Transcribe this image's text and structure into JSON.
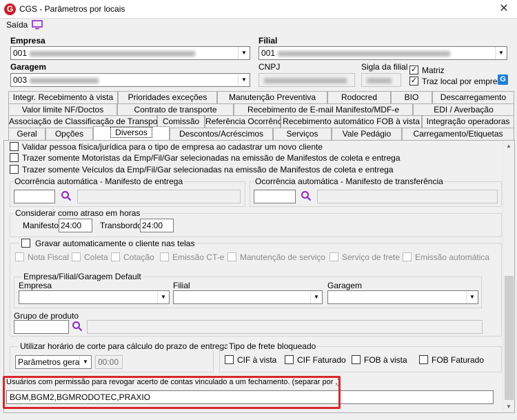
{
  "window": {
    "title": "CGS - Parâmetros por locais",
    "logo": "G",
    "close": "✕"
  },
  "menu": {
    "exit_label": "Saída"
  },
  "header": {
    "empresa_label": "Empresa",
    "empresa_code": "001",
    "filial_label": "Filial",
    "filial_code": "001",
    "garagem_label": "Garagem",
    "garagem_code": "003",
    "cnpj_label": "CNPJ",
    "sigla_label": "Sigla da filial",
    "matriz_label": "Matriz",
    "matriz_checked": "✓",
    "traz_local_label": "Traz local por empresa",
    "traz_local_checked": "✓",
    "refresh_icon": "G"
  },
  "tabs": {
    "row1": [
      "Integr. Recebimento à vista",
      "Prioridades exceções",
      "Manutenção Preventiva",
      "Rodocred",
      "BIO",
      "Descarregamento"
    ],
    "row2": [
      "Valor limite NF/Doctos",
      "Contrato de transporte",
      "Recebimento de E-mail Manifesto/MDF-e",
      "EDI / Averbação"
    ],
    "row3": [
      "Associação de Classificação de Transporte",
      "Comissão",
      "Referência Ocorrência",
      "Recebimento automático FOB à vista",
      "Integração operadoras"
    ],
    "row4": [
      "Geral",
      "Opções",
      "Diversos",
      "Descontos/Acréscimos",
      "Serviços",
      "Vale Pedágio",
      "Carregamento/Etiquetas"
    ],
    "active": "Diversos"
  },
  "options": {
    "validar": "Validar pessoa física/jurídica para o tipo de empresa ao cadastrar um novo cliente",
    "motoristas": "Trazer somente Motoristas da Emp/Fil/Gar selecionadas na emissão de Manifestos de coleta e entrega",
    "veiculos": "Trazer somente Veículos da Emp/Fil/Gar selecionadas na emissão de Manifestos de coleta e entrega"
  },
  "ocorrencia": {
    "entrega_label": "Ocorrência automática - Manifesto de entrega",
    "transf_label": "Ocorrência automática - Manifesto de transferência"
  },
  "atraso": {
    "label": "Considerar como atraso em horas",
    "manifesto_label": "Manifesto",
    "manifesto_value": "24:00",
    "transbordo_label": "Transbordo",
    "transbordo_value": "24:00"
  },
  "gravar": {
    "label": "Gravar automaticamente o cliente nas telas",
    "items": [
      "Nota Fiscal",
      "Coleta",
      "Cotação",
      "Emissão CT-e",
      "Manutenção de serviço",
      "Serviço de frete",
      "Emissão automática"
    ],
    "default_label": "Empresa/Filial/Garagem Default",
    "empresa_label": "Empresa",
    "filial_label": "Filial",
    "garagem_label": "Garagem"
  },
  "produto": {
    "label": "Grupo de produto"
  },
  "corte": {
    "label": "Utilizar horário de corte para cálculo do prazo de entrega",
    "select_value": "Parâmetros gerais",
    "time_value": "00:00"
  },
  "frete": {
    "label": "Tipo de frete bloqueado",
    "items": [
      "CIF à vista",
      "CIF Faturado",
      "FOB à vista",
      "FOB Faturado"
    ]
  },
  "usuarios": {
    "label": "Usuários com permissão para revogar acerto de contas vinculado a um fechamento. (separar por ,)",
    "value": "BGM,BGM2,BGMRODOTEC,PRAXIO"
  },
  "colors": {
    "highlight": "#d9262c",
    "accent": "#c8202a",
    "menu_icon": "#8b27c9"
  }
}
